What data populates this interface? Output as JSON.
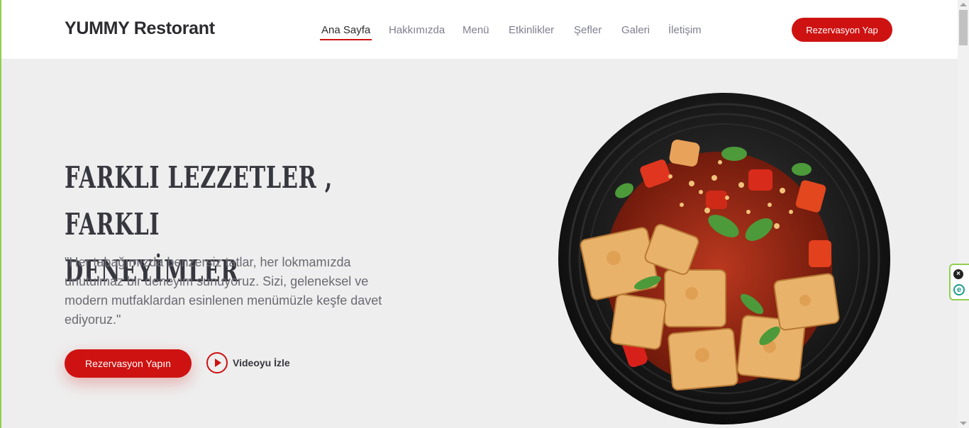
{
  "header": {
    "logo": "YUMMY Restorant",
    "nav": [
      {
        "label": "Ana Sayfa",
        "active": true
      },
      {
        "label": "Hakkımızda",
        "active": false
      },
      {
        "label": "Menü",
        "active": false
      },
      {
        "label": "Etkinlikler",
        "active": false
      },
      {
        "label": "Şefler",
        "active": false
      },
      {
        "label": "Galeri",
        "active": false
      },
      {
        "label": "İletişim",
        "active": false
      }
    ],
    "cta_label": "Rezervasyon Yap"
  },
  "hero": {
    "title_line1": "FARKLI LEZZETLER , FARKLI",
    "title_line2": "DENEYİMLER",
    "text": "\"Her tabağımızda benzersiz tatlar, her lokmamızda unutulmaz bir deneyim sunuyoruz. Sizi, geleneksel ve modern mutfaklardan esinlenen menümüzle keşfe davet ediyoruz.\"",
    "book_label": "Rezervasyon Yapın",
    "video_label": "Videoyu İzle"
  },
  "colors": {
    "accent": "#ce1212",
    "background": "#eeeeee",
    "heading": "#37373f"
  },
  "icons": {
    "play": "play-circle-icon",
    "widget_close": "close-circle-icon",
    "widget_extension": "extension-e-icon"
  }
}
